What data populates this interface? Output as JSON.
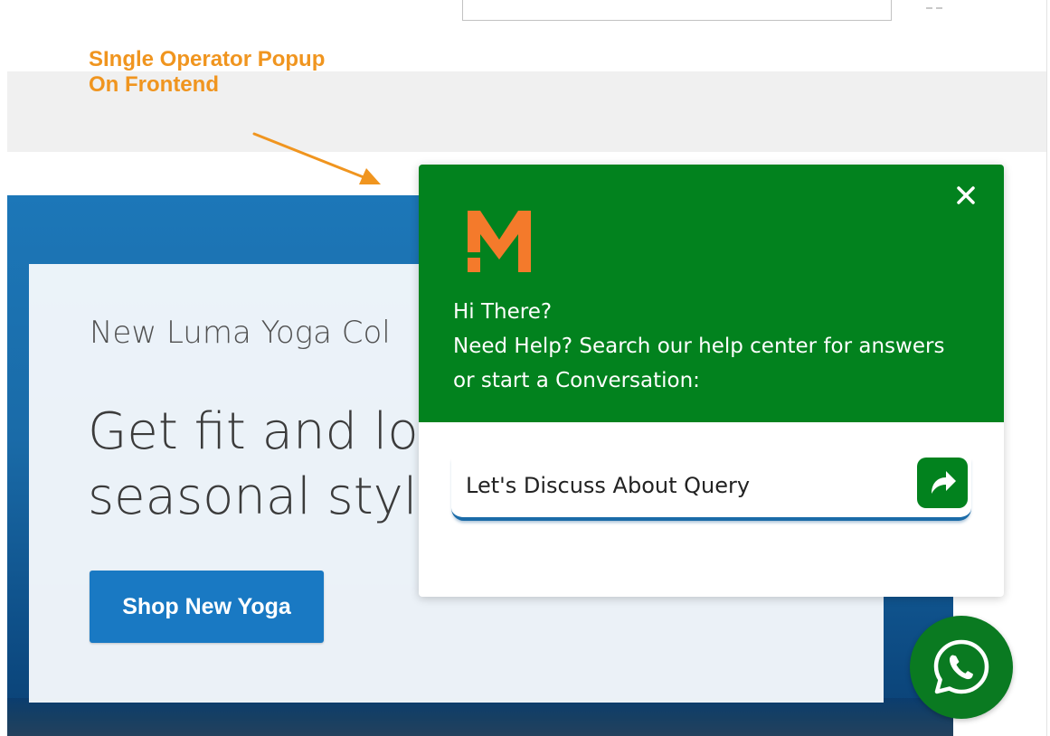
{
  "annotation": {
    "line1": "SIngle Operator Popup",
    "line2": "On Frontend",
    "color": "#f0951f"
  },
  "hero": {
    "kicker": "New Luma Yoga Col",
    "title_line1": "Get fit and loo",
    "title_line2": "seasonal style",
    "button_label": "Shop New Yoga",
    "button_color": "#1979c3"
  },
  "chat_popup": {
    "header_color": "#02821e",
    "logo_icon": "m-brand-logo",
    "logo_color": "#f47a2b",
    "close_icon": "close-icon",
    "greeting": "Hi There?",
    "help_line1": "Need Help? Search our help center for answers",
    "help_line2": "or start a Conversation:",
    "query_placeholder": "Let's Discuss About Query",
    "send_icon": "share-arrow-icon"
  },
  "whatsapp": {
    "icon": "whatsapp-icon",
    "color": "#0a7a21"
  }
}
